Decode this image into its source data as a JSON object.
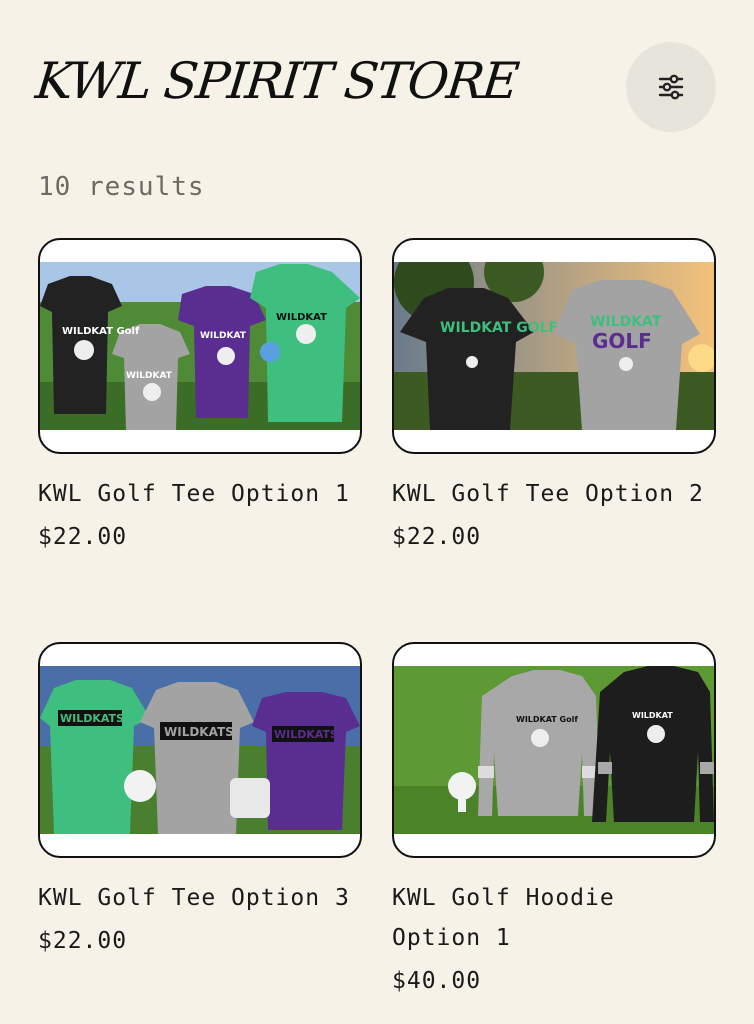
{
  "header": {
    "title": "KWL SPIRIT STORE",
    "filter_icon": "sliders-icon"
  },
  "results": {
    "count_label": "10 results"
  },
  "products": [
    {
      "name": "KWL Golf Tee Option 1",
      "price": "$22.00",
      "image_text": "WILDKAT Golf"
    },
    {
      "name": "KWL Golf Tee Option 2",
      "price": "$22.00",
      "image_text": "WILDKAT GOLF"
    },
    {
      "name": "KWL Golf Tee Option 3",
      "price": "$22.00",
      "image_text": "WILDKATS"
    },
    {
      "name": "KWL Golf Hoodie Option 1",
      "price": "$40.00",
      "image_text": "WILDKAT Golf"
    }
  ],
  "colors": {
    "background": "#f6f2e8",
    "shirt_black": "#222222",
    "shirt_gray": "#a3a3a3",
    "shirt_purple": "#5a2d91",
    "shirt_green": "#3fbf7f",
    "grass": "#3f7a2e"
  }
}
